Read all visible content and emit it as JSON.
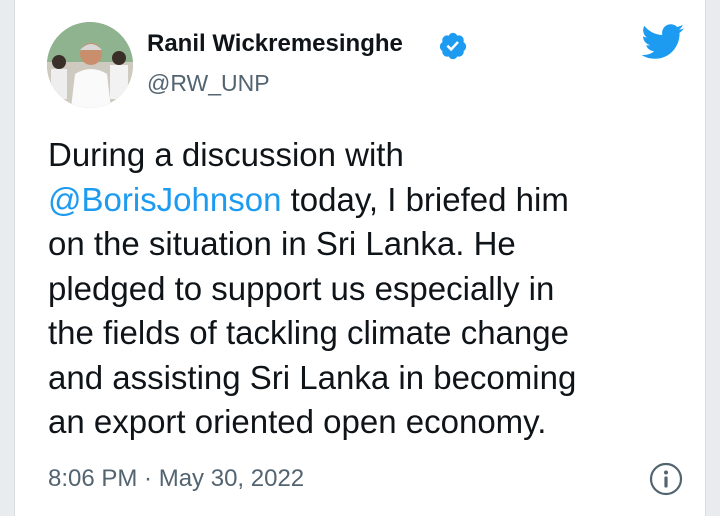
{
  "author": {
    "name": "Ranil Wickremesinghe",
    "handle": "@RW_UNP"
  },
  "tweet": {
    "line1": "During a discussion with",
    "mention": "@BorisJohnson",
    "line2_rest": " today, I briefed him",
    "line3": "on the situation in Sri Lanka. He",
    "line4": "pledged to support us especially in",
    "line5": "the fields of tackling climate change",
    "line6": "and assisting Sri Lanka in becoming",
    "line7": "an export oriented open economy."
  },
  "meta": {
    "time": "8:06 PM",
    "separator": " · ",
    "date": "May 30, 2022"
  },
  "icons": {
    "verified": "verified-badge-icon",
    "logo": "twitter-bird-icon",
    "info": "info-icon"
  },
  "colors": {
    "accent": "#1d9bf0",
    "text": "#0f1419",
    "secondary": "#536471"
  }
}
